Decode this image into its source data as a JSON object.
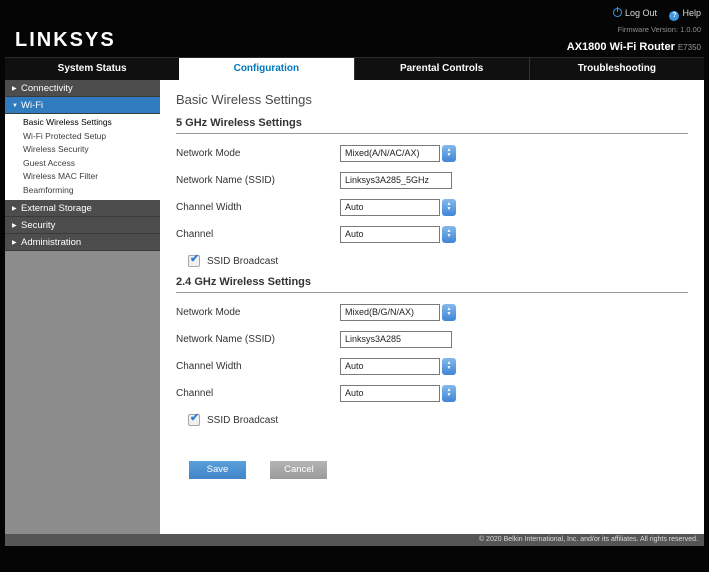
{
  "header": {
    "logo": "LINKSYS",
    "logout_label": "Log Out",
    "help_label": "Help",
    "firmware": "Firmware Version: 1.0.00",
    "model": "AX1800 Wi-Fi Router",
    "model_code": "E7350"
  },
  "tabs": {
    "system_status": "System Status",
    "configuration": "Configuration",
    "parental_controls": "Parental Controls",
    "troubleshooting": "Troubleshooting"
  },
  "sidebar": {
    "connectivity": "Connectivity",
    "wifi": "Wi-Fi",
    "sub": [
      "Basic Wireless Settings",
      "Wi-Fi Protected Setup",
      "Wireless Security",
      "Guest Access",
      "Wireless MAC Filter",
      "Beamforming"
    ],
    "external_storage": "External Storage",
    "security": "Security",
    "administration": "Administration"
  },
  "form": {
    "title": "Basic Wireless Settings",
    "section5": {
      "title": "5 GHz Wireless Settings",
      "network_mode_label": "Network Mode",
      "network_mode_value": "Mixed(A/N/AC/AX)",
      "ssid_label": "Network Name (SSID)",
      "ssid_value": "Linksys3A285_5GHz",
      "channel_width_label": "Channel Width",
      "channel_width_value": "Auto",
      "channel_label": "Channel",
      "channel_value": "Auto",
      "ssid_broadcast_label": "SSID Broadcast",
      "ssid_broadcast_checked": true
    },
    "section24": {
      "title": "2.4 GHz Wireless Settings",
      "network_mode_label": "Network Mode",
      "network_mode_value": "Mixed(B/G/N/AX)",
      "ssid_label": "Network Name (SSID)",
      "ssid_value": "Linksys3A285",
      "channel_width_label": "Channel Width",
      "channel_width_value": "Auto",
      "channel_label": "Channel",
      "channel_value": "Auto",
      "ssid_broadcast_label": "SSID Broadcast",
      "ssid_broadcast_checked": true
    },
    "save_label": "Save",
    "cancel_label": "Cancel"
  },
  "icons": {
    "collapsed": "▶",
    "expanded": "▼",
    "up": "▲",
    "down": "▼",
    "check": "✔",
    "help_glyph": "?"
  },
  "colors": {
    "accent_blue": "#0076bd",
    "wifi_highlight": "#2f7bbd",
    "save_button": "#4a92d4"
  },
  "footer": {
    "copyright": "© 2020 Belkin International, Inc. and/or its affiliates. All rights reserved."
  }
}
